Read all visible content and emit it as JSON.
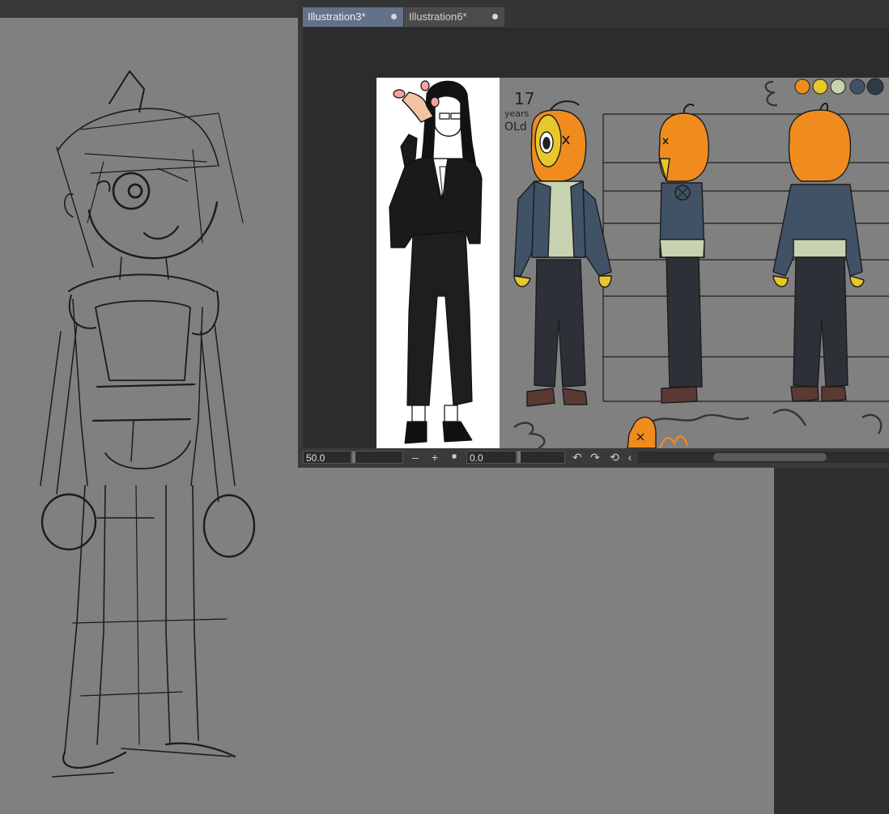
{
  "tabs": [
    {
      "label": "Illustration3*",
      "active": true
    },
    {
      "label": "Illustration6*",
      "active": false
    }
  ],
  "artwork": {
    "age_number": "17",
    "age_years": "years",
    "age_old": "OLd"
  },
  "palette": [
    "#f08c1e",
    "#e8c72a",
    "#c7d2b0",
    "#415266",
    "#2c3a4a"
  ],
  "statusbar": {
    "zoom": "50.0",
    "rotation": "0.0",
    "minus_label": "–",
    "plus_label": "+",
    "fit_label": "■",
    "rotate_left_label": "↶",
    "rotate_right_label": "↷",
    "reset_label": "⟲",
    "arrow_left_label": "‹"
  }
}
